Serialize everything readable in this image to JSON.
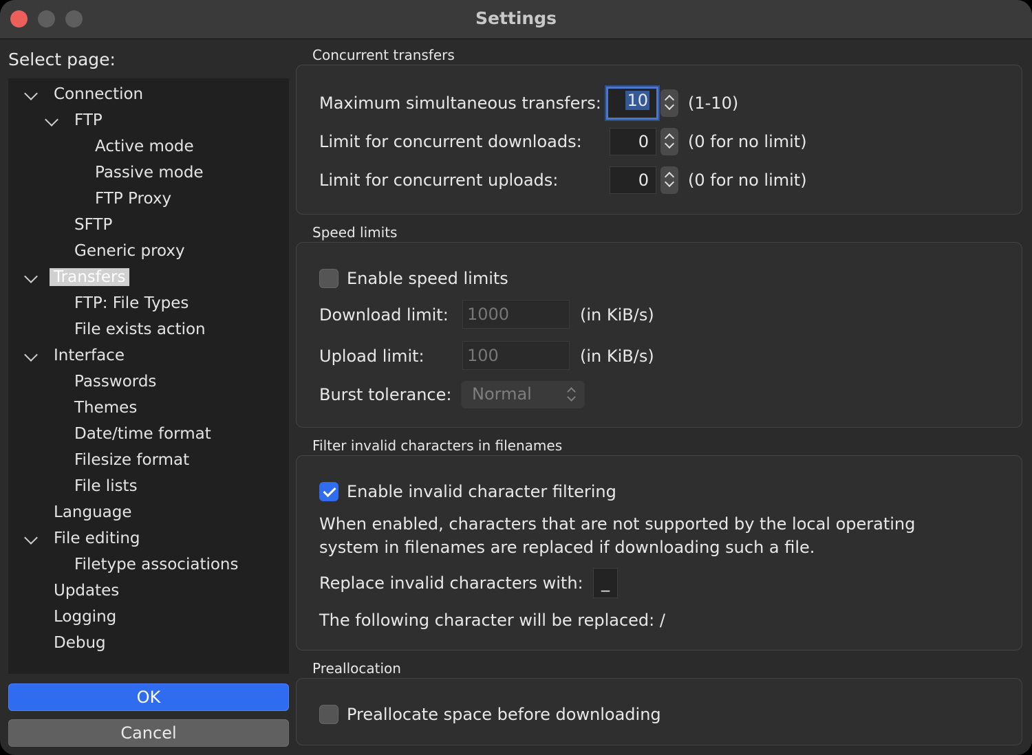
{
  "window": {
    "title": "Settings"
  },
  "sidebar": {
    "label": "Select page:",
    "items": [
      {
        "label": "Connection",
        "expanded": true
      },
      {
        "label": "FTP",
        "expanded": true
      },
      {
        "label": "Active mode"
      },
      {
        "label": "Passive mode"
      },
      {
        "label": "FTP Proxy"
      },
      {
        "label": "SFTP"
      },
      {
        "label": "Generic proxy"
      },
      {
        "label": "Transfers",
        "expanded": true,
        "selected": true
      },
      {
        "label": "FTP: File Types"
      },
      {
        "label": "File exists action"
      },
      {
        "label": "Interface",
        "expanded": true
      },
      {
        "label": "Passwords"
      },
      {
        "label": "Themes"
      },
      {
        "label": "Date/time format"
      },
      {
        "label": "Filesize format"
      },
      {
        "label": "File lists"
      },
      {
        "label": "Language"
      },
      {
        "label": "File editing",
        "expanded": true
      },
      {
        "label": "Filetype associations"
      },
      {
        "label": "Updates"
      },
      {
        "label": "Logging"
      },
      {
        "label": "Debug"
      }
    ]
  },
  "buttons": {
    "ok": "OK",
    "cancel": "Cancel"
  },
  "concurrent": {
    "title": "Concurrent transfers",
    "max_label": "Maximum simultaneous transfers:",
    "max_value": "10",
    "max_hint": "(1-10)",
    "downloads_label": "Limit for concurrent downloads:",
    "downloads_value": "0",
    "downloads_hint": "(0 for no limit)",
    "uploads_label": "Limit for concurrent uploads:",
    "uploads_value": "0",
    "uploads_hint": "(0 for no limit)"
  },
  "speed": {
    "title": "Speed limits",
    "enable_label": "Enable speed limits",
    "enabled": false,
    "download_label": "Download limit:",
    "download_value": "1000",
    "download_unit": "(in KiB/s)",
    "upload_label": "Upload limit:",
    "upload_value": "100",
    "upload_unit": "(in KiB/s)",
    "burst_label": "Burst tolerance:",
    "burst_value": "Normal"
  },
  "filter": {
    "title": "Filter invalid characters in filenames",
    "enable_label": "Enable invalid character filtering",
    "enabled": true,
    "desc_line1": "When enabled, characters that are not supported by the local operating",
    "desc_line2": "system in filenames are replaced if downloading such a file.",
    "replace_label": "Replace invalid characters with:",
    "replace_value": "_",
    "following_label": "The following character will be replaced: /"
  },
  "prealloc": {
    "title": "Preallocation",
    "enable_label": "Preallocate space before downloading",
    "enabled": false
  },
  "colors": {
    "accent": "#2f6cf0",
    "close": "#ec5f5b",
    "window_bg": "#2b2b2b"
  }
}
